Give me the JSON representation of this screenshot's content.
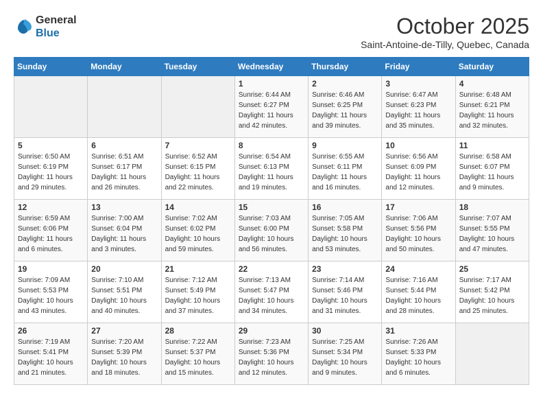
{
  "header": {
    "logo_line1": "General",
    "logo_line2": "Blue",
    "month": "October 2025",
    "location": "Saint-Antoine-de-Tilly, Quebec, Canada"
  },
  "weekdays": [
    "Sunday",
    "Monday",
    "Tuesday",
    "Wednesday",
    "Thursday",
    "Friday",
    "Saturday"
  ],
  "weeks": [
    [
      {
        "day": "",
        "info": ""
      },
      {
        "day": "",
        "info": ""
      },
      {
        "day": "",
        "info": ""
      },
      {
        "day": "1",
        "info": "Sunrise: 6:44 AM\nSunset: 6:27 PM\nDaylight: 11 hours\nand 42 minutes."
      },
      {
        "day": "2",
        "info": "Sunrise: 6:46 AM\nSunset: 6:25 PM\nDaylight: 11 hours\nand 39 minutes."
      },
      {
        "day": "3",
        "info": "Sunrise: 6:47 AM\nSunset: 6:23 PM\nDaylight: 11 hours\nand 35 minutes."
      },
      {
        "day": "4",
        "info": "Sunrise: 6:48 AM\nSunset: 6:21 PM\nDaylight: 11 hours\nand 32 minutes."
      }
    ],
    [
      {
        "day": "5",
        "info": "Sunrise: 6:50 AM\nSunset: 6:19 PM\nDaylight: 11 hours\nand 29 minutes."
      },
      {
        "day": "6",
        "info": "Sunrise: 6:51 AM\nSunset: 6:17 PM\nDaylight: 11 hours\nand 26 minutes."
      },
      {
        "day": "7",
        "info": "Sunrise: 6:52 AM\nSunset: 6:15 PM\nDaylight: 11 hours\nand 22 minutes."
      },
      {
        "day": "8",
        "info": "Sunrise: 6:54 AM\nSunset: 6:13 PM\nDaylight: 11 hours\nand 19 minutes."
      },
      {
        "day": "9",
        "info": "Sunrise: 6:55 AM\nSunset: 6:11 PM\nDaylight: 11 hours\nand 16 minutes."
      },
      {
        "day": "10",
        "info": "Sunrise: 6:56 AM\nSunset: 6:09 PM\nDaylight: 11 hours\nand 12 minutes."
      },
      {
        "day": "11",
        "info": "Sunrise: 6:58 AM\nSunset: 6:07 PM\nDaylight: 11 hours\nand 9 minutes."
      }
    ],
    [
      {
        "day": "12",
        "info": "Sunrise: 6:59 AM\nSunset: 6:06 PM\nDaylight: 11 hours\nand 6 minutes."
      },
      {
        "day": "13",
        "info": "Sunrise: 7:00 AM\nSunset: 6:04 PM\nDaylight: 11 hours\nand 3 minutes."
      },
      {
        "day": "14",
        "info": "Sunrise: 7:02 AM\nSunset: 6:02 PM\nDaylight: 10 hours\nand 59 minutes."
      },
      {
        "day": "15",
        "info": "Sunrise: 7:03 AM\nSunset: 6:00 PM\nDaylight: 10 hours\nand 56 minutes."
      },
      {
        "day": "16",
        "info": "Sunrise: 7:05 AM\nSunset: 5:58 PM\nDaylight: 10 hours\nand 53 minutes."
      },
      {
        "day": "17",
        "info": "Sunrise: 7:06 AM\nSunset: 5:56 PM\nDaylight: 10 hours\nand 50 minutes."
      },
      {
        "day": "18",
        "info": "Sunrise: 7:07 AM\nSunset: 5:55 PM\nDaylight: 10 hours\nand 47 minutes."
      }
    ],
    [
      {
        "day": "19",
        "info": "Sunrise: 7:09 AM\nSunset: 5:53 PM\nDaylight: 10 hours\nand 43 minutes."
      },
      {
        "day": "20",
        "info": "Sunrise: 7:10 AM\nSunset: 5:51 PM\nDaylight: 10 hours\nand 40 minutes."
      },
      {
        "day": "21",
        "info": "Sunrise: 7:12 AM\nSunset: 5:49 PM\nDaylight: 10 hours\nand 37 minutes."
      },
      {
        "day": "22",
        "info": "Sunrise: 7:13 AM\nSunset: 5:47 PM\nDaylight: 10 hours\nand 34 minutes."
      },
      {
        "day": "23",
        "info": "Sunrise: 7:14 AM\nSunset: 5:46 PM\nDaylight: 10 hours\nand 31 minutes."
      },
      {
        "day": "24",
        "info": "Sunrise: 7:16 AM\nSunset: 5:44 PM\nDaylight: 10 hours\nand 28 minutes."
      },
      {
        "day": "25",
        "info": "Sunrise: 7:17 AM\nSunset: 5:42 PM\nDaylight: 10 hours\nand 25 minutes."
      }
    ],
    [
      {
        "day": "26",
        "info": "Sunrise: 7:19 AM\nSunset: 5:41 PM\nDaylight: 10 hours\nand 21 minutes."
      },
      {
        "day": "27",
        "info": "Sunrise: 7:20 AM\nSunset: 5:39 PM\nDaylight: 10 hours\nand 18 minutes."
      },
      {
        "day": "28",
        "info": "Sunrise: 7:22 AM\nSunset: 5:37 PM\nDaylight: 10 hours\nand 15 minutes."
      },
      {
        "day": "29",
        "info": "Sunrise: 7:23 AM\nSunset: 5:36 PM\nDaylight: 10 hours\nand 12 minutes."
      },
      {
        "day": "30",
        "info": "Sunrise: 7:25 AM\nSunset: 5:34 PM\nDaylight: 10 hours\nand 9 minutes."
      },
      {
        "day": "31",
        "info": "Sunrise: 7:26 AM\nSunset: 5:33 PM\nDaylight: 10 hours\nand 6 minutes."
      },
      {
        "day": "",
        "info": ""
      }
    ]
  ]
}
